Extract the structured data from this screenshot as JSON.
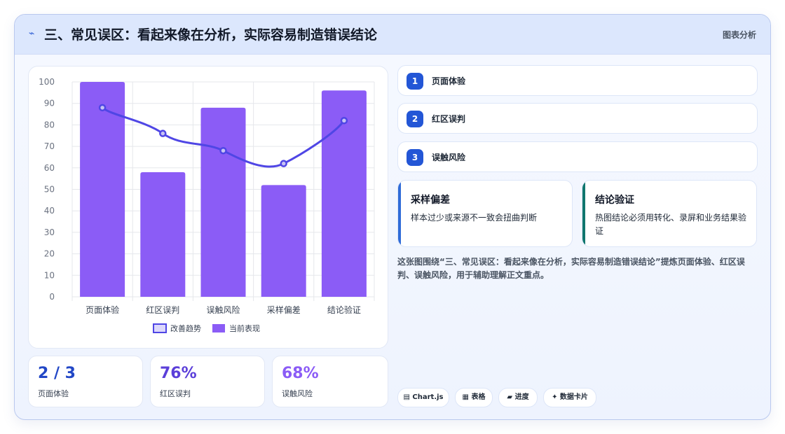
{
  "header": {
    "icon": "bolt-icon",
    "title": "三、常见误区：看起来像在分析，实际容易制造错误结论",
    "tag": "图表分析"
  },
  "chart_data": {
    "type": "bar",
    "categories": [
      "页面体验",
      "红区误判",
      "误触风险",
      "采样偏差",
      "结论验证"
    ],
    "series": [
      {
        "name": "改善趋势",
        "type": "line",
        "color": "#4f46e5",
        "values": [
          88,
          76,
          68,
          62,
          82
        ]
      },
      {
        "name": "当前表现",
        "type": "bar",
        "color": "#8b5cf6",
        "values": [
          100,
          58,
          88,
          52,
          96
        ]
      }
    ],
    "yticks": [
      "0",
      "10",
      "20",
      "30",
      "40",
      "50",
      "60",
      "70",
      "80",
      "90",
      "100"
    ],
    "ylim": [
      0,
      100
    ],
    "legend": "bottom",
    "grid": true
  },
  "stats": [
    {
      "value": "2 / 3",
      "label": "页面体验",
      "color": "#2247c6"
    },
    {
      "value": "76%",
      "label": "红区误判",
      "color": "#5b3fd9"
    },
    {
      "value": "68%",
      "label": "误触风险",
      "color": "#8b5cf6"
    }
  ],
  "steps": [
    {
      "num": "1",
      "label": "页面体验"
    },
    {
      "num": "2",
      "label": "红区误判"
    },
    {
      "num": "3",
      "label": "误触风险"
    }
  ],
  "info_cards": [
    {
      "title": "采样偏差",
      "text": "样本过少或来源不一致会扭曲判断",
      "accent": "#2f6bd8"
    },
    {
      "title": "结论验证",
      "text": "热图结论必须用转化、录屏和业务结果验证",
      "accent": "#0f766e"
    }
  ],
  "summary": "这张图围绕“三、常见误区：看起来像在分析，实际容易制造错误结论”提炼页面体验、红区误判、误触风险，用于辅助理解正文重点。",
  "chips": [
    {
      "label": "▤ Chart.js"
    },
    {
      "label": "▦ 表格"
    },
    {
      "label": "▰ 进度"
    },
    {
      "label": "✦ 数据卡片"
    }
  ]
}
